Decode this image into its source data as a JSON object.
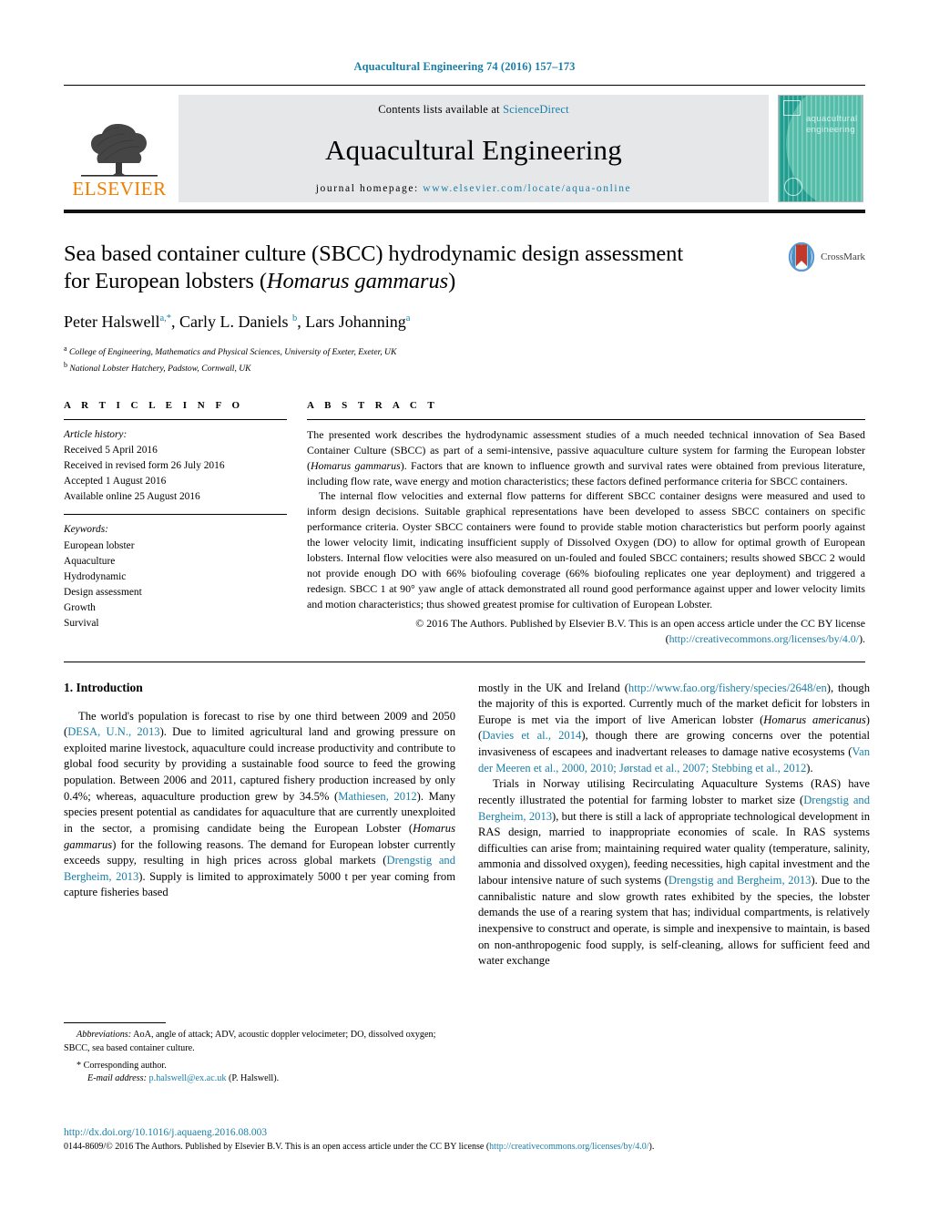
{
  "running_head": "Aquacultural Engineering 74 (2016) 157–173",
  "masthead": {
    "publisher": "ELSEVIER",
    "contents_prefix": "Contents lists available at ",
    "contents_link": "ScienceDirect",
    "journal_title": "Aquacultural Engineering",
    "homepage_prefix": "journal homepage: ",
    "homepage_url": "www.elsevier.com/locate/aqua-online",
    "cover_title_line1": "aquacultural",
    "cover_title_line2": "engineering",
    "accent_color": "#1a7fa8",
    "elsevier_orange": "#ef7d00",
    "cover_green": "#1f9d8e"
  },
  "article": {
    "title_line1": "Sea based container culture (SBCC) hydrodynamic design assessment",
    "title_line2_pre": "for European lobsters (",
    "title_line2_italic": "Homarus gammarus",
    "title_line2_post": ")",
    "crossmark_label": "CrossMark",
    "authors": "Peter Halswell, Carly L. Daniels, Lars Johanning",
    "author1": "Peter Halswell",
    "author1_sup": "a,*",
    "author2": "Carly L. Daniels",
    "author2_sup": "b",
    "author3": "Lars Johanning",
    "author3_sup": "a",
    "affiliation_a_sup": "a",
    "affiliation_a": "College of Engineering, Mathematics and Physical Sciences, University of Exeter, Exeter, UK",
    "affiliation_b_sup": "b",
    "affiliation_b": "National Lobster Hatchery, Padstow, Cornwall, UK"
  },
  "article_info": {
    "heading": "A R T I C L E  I N F O",
    "history_label": "Article history:",
    "history": [
      "Received 5 April 2016",
      "Received in revised form 26 July 2016",
      "Accepted 1 August 2016",
      "Available online 25 August 2016"
    ],
    "keywords_label": "Keywords:",
    "keywords": [
      "European lobster",
      "Aquaculture",
      "Hydrodynamic",
      "Design assessment",
      "Growth",
      "Survival"
    ]
  },
  "abstract": {
    "heading": "A B S T R A C T",
    "p1_a": "The presented work describes the hydrodynamic assessment studies of a much needed technical innovation of Sea Based Container Culture (SBCC) as part of a semi-intensive, passive aquaculture culture system for farming the European lobster (",
    "p1_italic": "Homarus gammarus",
    "p1_b": "). Factors that are known to influence growth and survival rates were obtained from previous literature, including flow rate, wave energy and motion characteristics; these factors defined performance criteria for SBCC containers.",
    "p2": "The internal flow velocities and external flow patterns for different SBCC container designs were measured and used to inform design decisions. Suitable graphical representations have been developed to assess SBCC containers on specific performance criteria. Oyster SBCC containers were found to provide stable motion characteristics but perform poorly against the lower velocity limit, indicating insufficient supply of Dissolved Oxygen (DO) to allow for optimal growth of European lobsters. Internal flow velocities were also measured on un-fouled and fouled SBCC containers; results showed SBCC 2 would not provide enough DO with 66% biofouling coverage (66% biofouling replicates one year deployment) and triggered a redesign. SBCC 1 at 90° yaw angle of attack demonstrated all round good performance against upper and lower velocity limits and motion characteristics; thus showed greatest promise for cultivation of European Lobster.",
    "copyright_text": "© 2016 The Authors. Published by Elsevier B.V. This is an open access article under the CC BY license",
    "copyright_license_open": "(",
    "copyright_license_url": "http://creativecommons.org/licenses/by/4.0/",
    "copyright_license_close": ")."
  },
  "introduction": {
    "heading": "1.  Introduction",
    "left": {
      "p1_a": "The world's population is forecast to rise by one third between 2009 and 2050 (",
      "p1_cite1": "DESA, U.N., 2013",
      "p1_b": "). Due to limited agricultural land and growing pressure on exploited marine livestock, aquaculture could increase productivity and contribute to global food security by providing a sustainable food source to feed the growing population. Between 2006 and 2011, captured fishery production increased by only 0.4%; whereas, aquaculture production grew by 34.5% (",
      "p1_cite2": "Mathiesen, 2012",
      "p1_c": "). Many species present potential as candidates for aquaculture that are currently unexploited in the sector, a promising candidate being the European Lobster (",
      "p1_italic": "Homarus gammarus",
      "p1_d": ") for the following reasons. The demand for European lobster currently exceeds suppy, resulting in high prices across global markets (",
      "p1_cite3": "Drengstig and Bergheim, 2013",
      "p1_e": "). Supply is limited to approximately 5000 t per year coming from capture fisheries based"
    },
    "right": {
      "p1_a": "mostly in the UK and Ireland (",
      "p1_link": "http://www.fao.org/fishery/species/2648/en",
      "p1_b": "), though the majority of this is exported. Currently much of the market deficit for lobsters in Europe is met via the import of live American lobster (",
      "p1_italic": "Homarus americanus",
      "p1_c": ") (",
      "p1_cite1": "Davies et al., 2014",
      "p1_d": "), though there are growing concerns over the potential invasiveness of escapees and inadvertant releases to damage native ecosystems (",
      "p1_cite2": "Van der Meeren et al., 2000, 2010; Jørstad et al., 2007; Stebbing et al., 2012",
      "p1_e": ").",
      "p2_a": "Trials in Norway utilising Recirculating Aquaculture Systems (RAS) have recently illustrated the potential for farming lobster to market size (",
      "p2_cite1": "Drengstig and Bergheim, 2013",
      "p2_b": "), but there is still a lack of appropriate technological development in RAS design, married to inappropriate economies of scale. In RAS systems difficulties can arise from; maintaining required water quality (temperature, salinity, ammonia and dissolved oxygen), feeding necessities, high capital investment and the labour intensive nature of such systems (",
      "p2_cite2": "Drengstig and Bergheim, 2013",
      "p2_c": "). Due to the cannibalistic nature and slow growth rates exhibited by the species, the lobster demands the use of a rearing system that has; individual compartments, is relatively inexpensive to construct and operate, is simple and inexpensive to maintain, is based on non-anthropogenic food supply, is self-cleaning, allows for sufficient feed and water exchange"
    }
  },
  "footnotes": {
    "abbrev_label": "Abbreviations:",
    "abbrev_text": " AoA, angle of attack; ADV, acoustic doppler velocimeter; DO, dissolved oxygen; SBCC, sea based container culture.",
    "corresponding_star": "*",
    "corresponding_text": "Corresponding author.",
    "email_label": "E-mail address:",
    "email_value": "p.halswell@ex.ac.uk",
    "email_owner": "(P. Halswell)."
  },
  "bottom": {
    "doi": "http://dx.doi.org/10.1016/j.aquaeng.2016.08.003",
    "issn_a": "0144-8609/© 2016 The Authors. Published by Elsevier B.V. This is an open access article under the CC BY license (",
    "issn_link": "http://creativecommons.org/licenses/by/4.0/",
    "issn_b": ")."
  }
}
